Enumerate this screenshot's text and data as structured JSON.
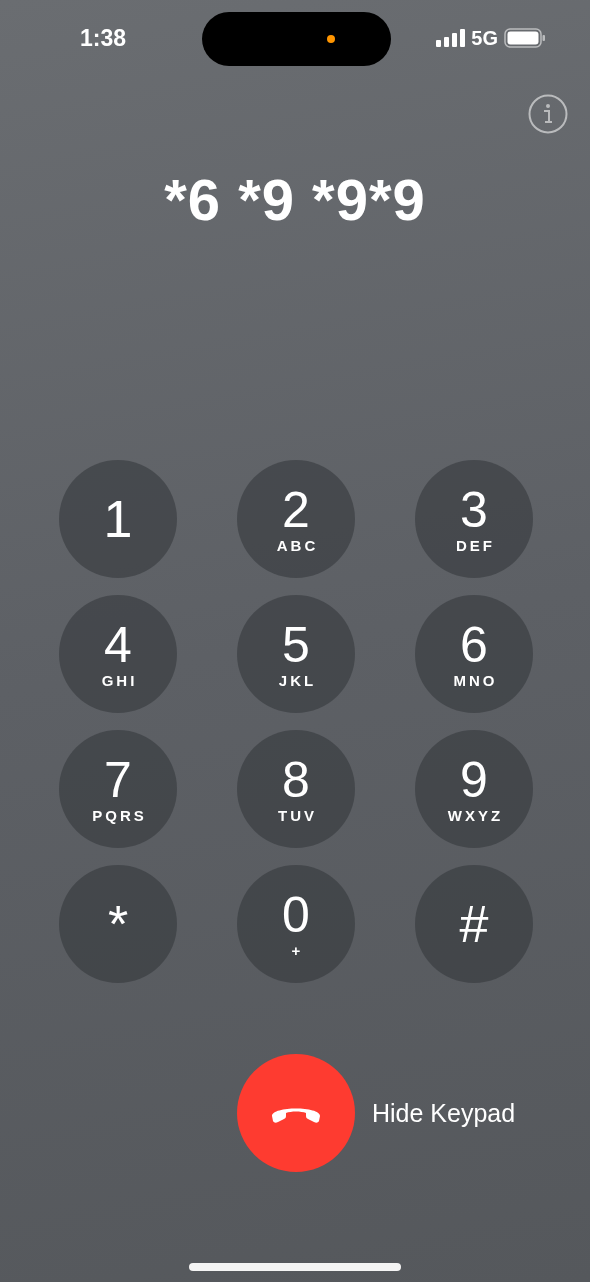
{
  "status_bar": {
    "time": "1:38",
    "network": "5G",
    "camera_in_use": true
  },
  "dialed_number": "*6 *9 *9*9",
  "keypad": [
    {
      "digit": "1"
    },
    {
      "digit": "2",
      "letters": "ABC"
    },
    {
      "digit": "3",
      "letters": "DEF"
    },
    {
      "digit": "4",
      "letters": "GHI"
    },
    {
      "digit": "5",
      "letters": "JKL"
    },
    {
      "digit": "6",
      "letters": "MNO"
    },
    {
      "digit": "7",
      "letters": "PQRS"
    },
    {
      "digit": "8",
      "letters": "TUV"
    },
    {
      "digit": "9",
      "letters": "WXYZ"
    },
    {
      "digit": "*"
    },
    {
      "digit": "0",
      "letters": "+"
    },
    {
      "digit": "#"
    }
  ],
  "hide_keypad_label": "Hide Keypad"
}
